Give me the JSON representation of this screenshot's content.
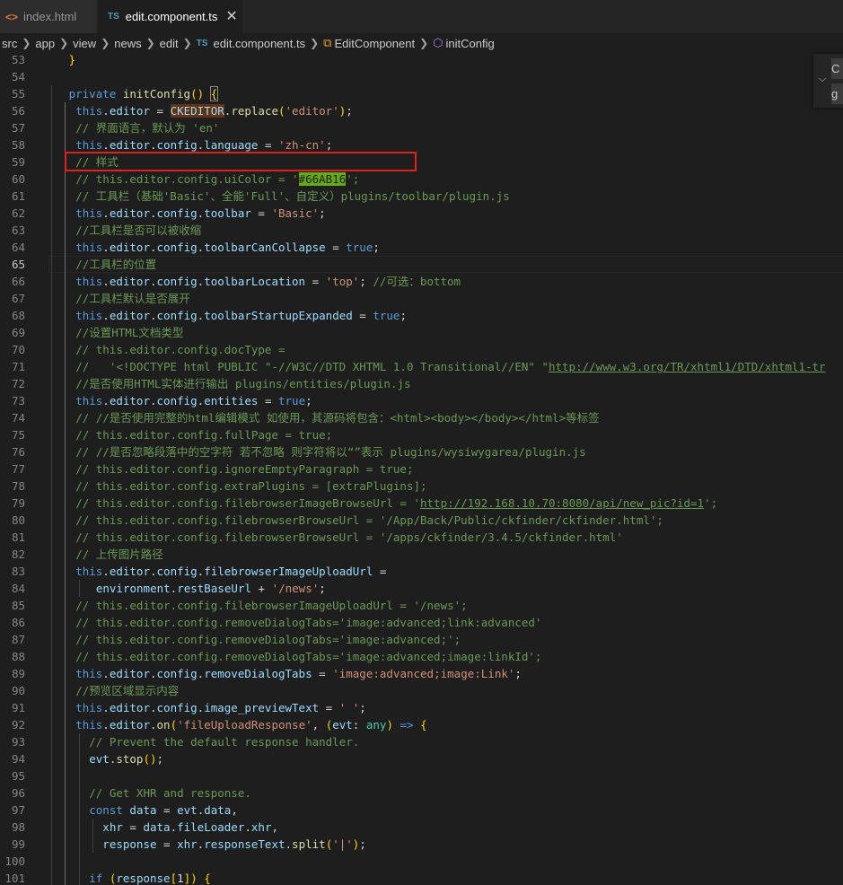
{
  "tabs": [
    {
      "icon": "<>",
      "label": "index.html",
      "active": false
    },
    {
      "icon": "TS",
      "label": "edit.component.ts",
      "active": true,
      "close": "✕"
    }
  ],
  "breadcrumb": {
    "segments": [
      "src",
      "app",
      "view",
      "news",
      "edit"
    ],
    "file_icon": "TS",
    "file": "edit.component.ts",
    "class": "EditComponent",
    "method": "initConfig"
  },
  "find_widget": {
    "find_value": "C",
    "replace_value": "g",
    "toggle_icon": "chevron-down"
  },
  "active_line": 65,
  "line_numbers": [
    "53",
    "54",
    "55",
    "56",
    "57",
    "58",
    "59",
    "60",
    "61",
    "62",
    "63",
    "64",
    "65",
    "66",
    "67",
    "68",
    "69",
    "70",
    "71",
    "72",
    "73",
    "74",
    "75",
    "76",
    "77",
    "78",
    "79",
    "80",
    "81",
    "82",
    "83",
    "84",
    "85",
    "86",
    "87",
    "88",
    "89",
    "90",
    "91",
    "92",
    "93",
    "94",
    "95",
    "96",
    "97",
    "98",
    "99",
    "100",
    "101"
  ],
  "code_lines": [
    [
      [
        "}",
        "y",
        ""
      ]
    ],
    [],
    [
      [
        "private",
        "k",
        ""
      ],
      [
        " ",
        "d",
        ""
      ],
      [
        "initConfig",
        "f",
        ""
      ],
      [
        "()",
        "y",
        ""
      ],
      [
        " ",
        "d",
        ""
      ],
      [
        "{",
        "y",
        "bracket-box"
      ]
    ],
    [
      [
        "this",
        "k",
        ""
      ],
      [
        ".",
        "d",
        ""
      ],
      [
        "editor",
        "p",
        ""
      ],
      [
        " = ",
        "d",
        ""
      ],
      [
        "CKEDITOR",
        "p",
        "hl"
      ],
      [
        ".",
        "d",
        ""
      ],
      [
        "replace",
        "f",
        ""
      ],
      [
        "(",
        "y",
        ""
      ],
      [
        "'editor'",
        "s",
        ""
      ],
      [
        ")",
        "y",
        ""
      ],
      [
        ";",
        "d",
        ""
      ]
    ],
    [
      [
        "// 界面语言，默认为 'en'",
        "c",
        ""
      ]
    ],
    [
      [
        "this",
        "k",
        ""
      ],
      [
        ".",
        "d",
        ""
      ],
      [
        "editor",
        "p",
        ""
      ],
      [
        ".",
        "d",
        ""
      ],
      [
        "config",
        "p",
        ""
      ],
      [
        ".",
        "d",
        ""
      ],
      [
        "language",
        "p",
        ""
      ],
      [
        " = ",
        "d",
        ""
      ],
      [
        "'zh-cn'",
        "s",
        ""
      ],
      [
        ";",
        "d",
        ""
      ]
    ],
    [
      [
        "// 样式",
        "c",
        ""
      ]
    ],
    [
      [
        "// this.editor.config.uiColor = '",
        "c",
        ""
      ],
      [
        "#66AB16",
        "c",
        "color-chip"
      ],
      [
        "';",
        "c",
        ""
      ]
    ],
    [
      [
        "// 工具栏（基础'Basic'、全能'Full'、自定义）plugins/toolbar/plugin.js",
        "c",
        ""
      ]
    ],
    [
      [
        "this",
        "k",
        ""
      ],
      [
        ".",
        "d",
        ""
      ],
      [
        "editor",
        "p",
        ""
      ],
      [
        ".",
        "d",
        ""
      ],
      [
        "config",
        "p",
        ""
      ],
      [
        ".",
        "d",
        ""
      ],
      [
        "toolbar",
        "p",
        ""
      ],
      [
        " = ",
        "d",
        ""
      ],
      [
        "'Basic'",
        "s",
        ""
      ],
      [
        ";",
        "d",
        ""
      ]
    ],
    [
      [
        "//工具栏是否可以被收缩",
        "c",
        ""
      ]
    ],
    [
      [
        "this",
        "k",
        ""
      ],
      [
        ".",
        "d",
        ""
      ],
      [
        "editor",
        "p",
        ""
      ],
      [
        ".",
        "d",
        ""
      ],
      [
        "config",
        "p",
        ""
      ],
      [
        ".",
        "d",
        ""
      ],
      [
        "toolbarCanCollapse",
        "p",
        ""
      ],
      [
        " = ",
        "d",
        ""
      ],
      [
        "true",
        "k",
        ""
      ],
      [
        ";",
        "d",
        ""
      ]
    ],
    [
      [
        "//工具栏的位置",
        "c",
        ""
      ]
    ],
    [
      [
        "this",
        "k",
        ""
      ],
      [
        ".",
        "d",
        ""
      ],
      [
        "editor",
        "p",
        ""
      ],
      [
        ".",
        "d",
        ""
      ],
      [
        "config",
        "p",
        ""
      ],
      [
        ".",
        "d",
        ""
      ],
      [
        "toolbarLocation",
        "p",
        ""
      ],
      [
        " = ",
        "d",
        ""
      ],
      [
        "'top'",
        "s",
        ""
      ],
      [
        "; ",
        "d",
        ""
      ],
      [
        "//可选：bottom",
        "c",
        ""
      ]
    ],
    [
      [
        "//工具栏默认是否展开",
        "c",
        ""
      ]
    ],
    [
      [
        "this",
        "k",
        ""
      ],
      [
        ".",
        "d",
        ""
      ],
      [
        "editor",
        "p",
        ""
      ],
      [
        ".",
        "d",
        ""
      ],
      [
        "config",
        "p",
        ""
      ],
      [
        ".",
        "d",
        ""
      ],
      [
        "toolbarStartupExpanded",
        "p",
        ""
      ],
      [
        " = ",
        "d",
        ""
      ],
      [
        "true",
        "k",
        ""
      ],
      [
        ";",
        "d",
        ""
      ]
    ],
    [
      [
        "//设置HTML文档类型",
        "c",
        ""
      ]
    ],
    [
      [
        "// this.editor.config.docType =",
        "c",
        ""
      ]
    ],
    [
      [
        "//   '<!DOCTYPE html PUBLIC \"-//W3C//DTD XHTML 1.0 Transitional//EN\" \"",
        "c",
        ""
      ],
      [
        "http://www.w3.org/TR/xhtml1/DTD/xhtml1-tr",
        "c",
        "u"
      ]
    ],
    [
      [
        "//是否使用HTML实体进行输出 plugins/entities/plugin.js",
        "c",
        ""
      ]
    ],
    [
      [
        "this",
        "k",
        ""
      ],
      [
        ".",
        "d",
        ""
      ],
      [
        "editor",
        "p",
        ""
      ],
      [
        ".",
        "d",
        ""
      ],
      [
        "config",
        "p",
        ""
      ],
      [
        ".",
        "d",
        ""
      ],
      [
        "entities",
        "p",
        ""
      ],
      [
        " = ",
        "d",
        ""
      ],
      [
        "true",
        "k",
        ""
      ],
      [
        ";",
        "d",
        ""
      ]
    ],
    [
      [
        "// //是否使用完整的html编辑模式 如使用，其源码将包含：<html><body></body></html>等标签",
        "c",
        ""
      ]
    ],
    [
      [
        "// this.editor.config.fullPage = true;",
        "c",
        ""
      ]
    ],
    [
      [
        "// //是否忽略段落中的空字符 若不忽略 则字符将以“”表示 plugins/wysiwygarea/plugin.js",
        "c",
        ""
      ]
    ],
    [
      [
        "// this.editor.config.ignoreEmptyParagraph = true;",
        "c",
        ""
      ]
    ],
    [
      [
        "// this.editor.config.extraPlugins = [extraPlugins];",
        "c",
        ""
      ]
    ],
    [
      [
        "// this.editor.config.filebrowserImageBrowseUrl = '",
        "c",
        ""
      ],
      [
        "http://192.168.10.70:8080/api/new_pic?id=1",
        "c",
        "u"
      ],
      [
        "';",
        "c",
        ""
      ]
    ],
    [
      [
        "// this.editor.config.filebrowserBrowseUrl = '/App/Back/Public/ckfinder/ckfinder.html';",
        "c",
        ""
      ]
    ],
    [
      [
        "// this.editor.config.filebrowserBrowseUrl = '/apps/ckfinder/3.4.5/ckfinder.html'",
        "c",
        ""
      ]
    ],
    [
      [
        "// 上传图片路径",
        "c",
        ""
      ]
    ],
    [
      [
        "this",
        "k",
        ""
      ],
      [
        ".",
        "d",
        ""
      ],
      [
        "editor",
        "p",
        ""
      ],
      [
        ".",
        "d",
        ""
      ],
      [
        "config",
        "p",
        ""
      ],
      [
        ".",
        "d",
        ""
      ],
      [
        "filebrowserImageUploadUrl",
        "p",
        ""
      ],
      [
        " =",
        "d",
        ""
      ]
    ],
    [
      [
        "  ",
        "d",
        ""
      ],
      [
        "environment",
        "p",
        ""
      ],
      [
        ".",
        "d",
        ""
      ],
      [
        "restBaseUrl",
        "p",
        ""
      ],
      [
        " + ",
        "d",
        ""
      ],
      [
        "'/news'",
        "s",
        ""
      ],
      [
        ";",
        "d",
        ""
      ]
    ],
    [
      [
        "// this.editor.config.filebrowserImageUploadUrl = '/news';",
        "c",
        ""
      ]
    ],
    [
      [
        "// this.editor.config.removeDialogTabs='image:advanced;link:advanced'",
        "c",
        ""
      ]
    ],
    [
      [
        "// this.editor.config.removeDialogTabs='image:advanced;';",
        "c",
        ""
      ]
    ],
    [
      [
        "// this.editor.config.removeDialogTabs='image:advanced;image:linkId';",
        "c",
        ""
      ]
    ],
    [
      [
        "this",
        "k",
        ""
      ],
      [
        ".",
        "d",
        ""
      ],
      [
        "editor",
        "p",
        ""
      ],
      [
        ".",
        "d",
        ""
      ],
      [
        "config",
        "p",
        ""
      ],
      [
        ".",
        "d",
        ""
      ],
      [
        "removeDialogTabs",
        "p",
        ""
      ],
      [
        " = ",
        "d",
        ""
      ],
      [
        "'image:advanced;image:Link'",
        "s",
        ""
      ],
      [
        ";",
        "d",
        ""
      ]
    ],
    [
      [
        "//预览区域显示内容",
        "c",
        ""
      ]
    ],
    [
      [
        "this",
        "k",
        ""
      ],
      [
        ".",
        "d",
        ""
      ],
      [
        "editor",
        "p",
        ""
      ],
      [
        ".",
        "d",
        ""
      ],
      [
        "config",
        "p",
        ""
      ],
      [
        ".",
        "d",
        ""
      ],
      [
        "image_previewText",
        "p",
        ""
      ],
      [
        " = ",
        "d",
        ""
      ],
      [
        "' '",
        "s",
        ""
      ],
      [
        ";",
        "d",
        ""
      ]
    ],
    [
      [
        "this",
        "k",
        ""
      ],
      [
        ".",
        "d",
        ""
      ],
      [
        "editor",
        "p",
        ""
      ],
      [
        ".",
        "d",
        ""
      ],
      [
        "on",
        "f",
        ""
      ],
      [
        "(",
        "y",
        ""
      ],
      [
        "'fileUploadResponse'",
        "s",
        ""
      ],
      [
        ", ",
        "d",
        ""
      ],
      [
        "(",
        "y",
        ""
      ],
      [
        "evt",
        "p",
        ""
      ],
      [
        ": ",
        "d",
        ""
      ],
      [
        "any",
        "t",
        ""
      ],
      [
        ")",
        "y",
        ""
      ],
      [
        " ",
        "d",
        ""
      ],
      [
        "=>",
        "k",
        ""
      ],
      [
        " ",
        "d",
        ""
      ],
      [
        "{",
        "y",
        ""
      ]
    ],
    [
      [
        "  ",
        "d",
        ""
      ],
      [
        "// Prevent the default response handler.",
        "c",
        ""
      ]
    ],
    [
      [
        "  ",
        "d",
        ""
      ],
      [
        "evt",
        "p",
        ""
      ],
      [
        ".",
        "d",
        ""
      ],
      [
        "stop",
        "f",
        ""
      ],
      [
        "()",
        "y",
        ""
      ],
      [
        ";",
        "d",
        ""
      ]
    ],
    [],
    [
      [
        "  ",
        "d",
        ""
      ],
      [
        "// Get XHR and response.",
        "c",
        ""
      ]
    ],
    [
      [
        "  ",
        "d",
        ""
      ],
      [
        "const",
        "k",
        ""
      ],
      [
        " ",
        "d",
        ""
      ],
      [
        "data",
        "p",
        ""
      ],
      [
        " = ",
        "d",
        ""
      ],
      [
        "evt",
        "p",
        ""
      ],
      [
        ".",
        "d",
        ""
      ],
      [
        "data",
        "p",
        ""
      ],
      [
        ",",
        "d",
        ""
      ]
    ],
    [
      [
        "    ",
        "d",
        ""
      ],
      [
        "xhr",
        "p",
        ""
      ],
      [
        " = ",
        "d",
        ""
      ],
      [
        "data",
        "p",
        ""
      ],
      [
        ".",
        "d",
        ""
      ],
      [
        "fileLoader",
        "p",
        ""
      ],
      [
        ".",
        "d",
        ""
      ],
      [
        "xhr",
        "p",
        ""
      ],
      [
        ",",
        "d",
        ""
      ]
    ],
    [
      [
        "    ",
        "d",
        ""
      ],
      [
        "response",
        "p",
        ""
      ],
      [
        " = ",
        "d",
        ""
      ],
      [
        "xhr",
        "p",
        ""
      ],
      [
        ".",
        "d",
        ""
      ],
      [
        "responseText",
        "p",
        ""
      ],
      [
        ".",
        "d",
        ""
      ],
      [
        "split",
        "f",
        ""
      ],
      [
        "(",
        "y",
        ""
      ],
      [
        "'|'",
        "s",
        ""
      ],
      [
        ")",
        "y",
        ""
      ],
      [
        ";",
        "d",
        ""
      ]
    ],
    [],
    [
      [
        "  ",
        "d",
        ""
      ],
      [
        "if",
        "k",
        ""
      ],
      [
        " ",
        "d",
        ""
      ],
      [
        "(",
        "y",
        ""
      ],
      [
        "response",
        "p",
        ""
      ],
      [
        "[",
        "y",
        ""
      ],
      [
        "1",
        "n",
        ""
      ],
      [
        "]",
        "y",
        ""
      ],
      [
        ")",
        "y",
        ""
      ],
      [
        " ",
        "d",
        ""
      ],
      [
        "{",
        "y",
        ""
      ]
    ]
  ]
}
